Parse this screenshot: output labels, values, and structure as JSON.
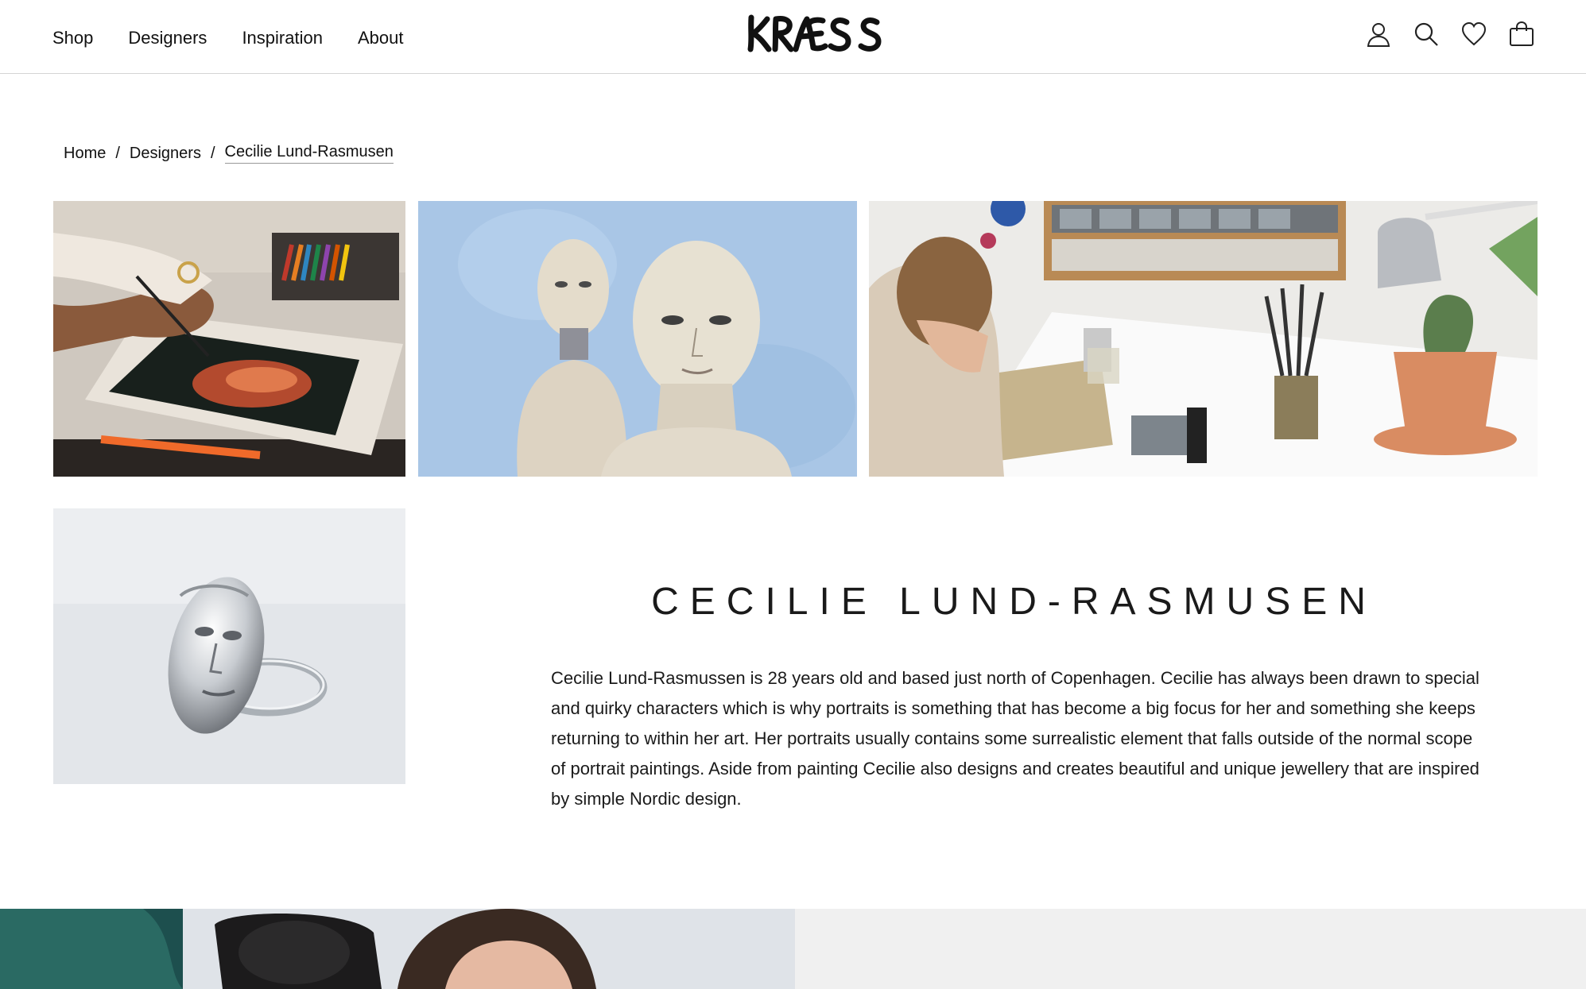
{
  "header": {
    "nav": [
      "Shop",
      "Designers",
      "Inspiration",
      "About"
    ],
    "logo_text": "KRAESS",
    "icons": [
      "account-icon",
      "search-icon",
      "heart-icon",
      "bag-icon"
    ]
  },
  "breadcrumb": {
    "home": "Home",
    "separator": "/",
    "designers": "Designers",
    "current": "Cecilie Lund-Rasmusen"
  },
  "designer": {
    "name": "CECILIE LUND-RASMUSEN",
    "bio": "Cecilie Lund-Rasmussen is 28 years old and based just north of Copenhagen. Cecilie has always been drawn to special and quirky characters which is why portraits is something that has become a big focus for her and something she keeps returning to within her art. Her portraits usually contains some surrealistic element that falls outside of the normal scope of portrait paintings. Aside from painting Cecilie also designs and creates beautiful and unique jewellery that are inspired by simple Nordic design."
  },
  "colors": {
    "text": "#111111",
    "divider": "#d4d4d4",
    "panel": "#f0f0f0"
  }
}
